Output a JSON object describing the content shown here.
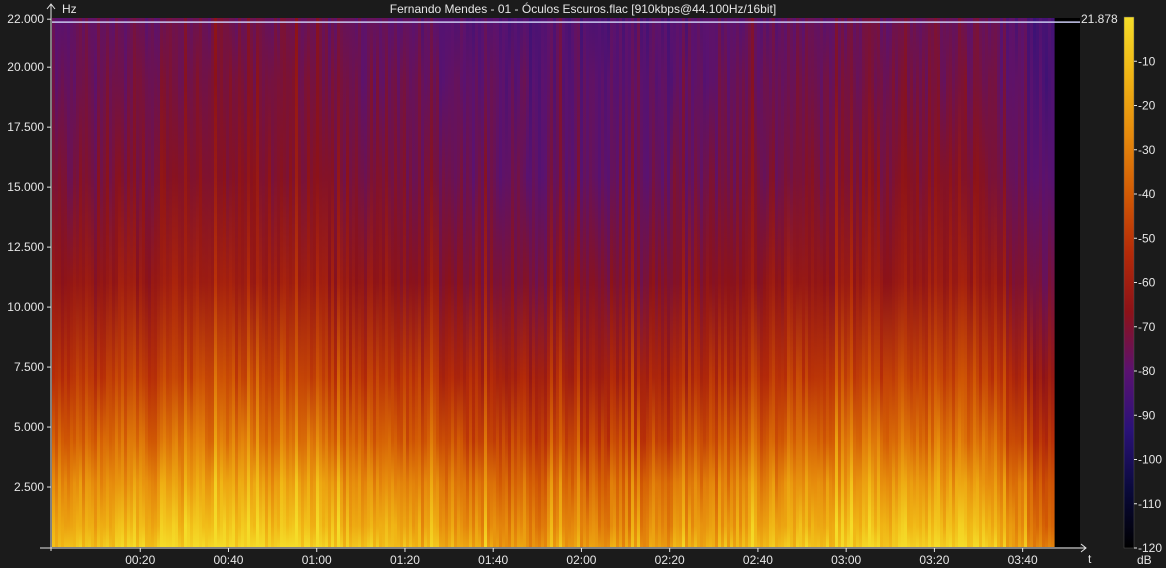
{
  "chart_data": {
    "type": "heatmap",
    "title": "Fernando Mendes - 01 - Óculos Escuros.flac [910kbps@44.100Hz/16bit]",
    "ylabel": "Hz",
    "xlabel": "t",
    "y_tick_labels": [
      "22.000",
      "20.000",
      "17.500",
      "15.000",
      "12.500",
      "10.000",
      "7.500",
      "5.000",
      "2.500"
    ],
    "y_tick_values": [
      22000,
      20000,
      17500,
      15000,
      12500,
      10000,
      7500,
      5000,
      2500
    ],
    "ylim": [
      0,
      22050
    ],
    "x_tick_labels": [
      "00:20",
      "00:40",
      "01:00",
      "01:20",
      "01:40",
      "02:00",
      "02:20",
      "02:40",
      "03:00",
      "03:20",
      "03:40"
    ],
    "x_tick_values": [
      20,
      40,
      60,
      80,
      100,
      120,
      140,
      160,
      180,
      200,
      220
    ],
    "xlim": [
      0,
      233
    ],
    "audio_end_seconds": 227,
    "cutoff_label": "21.878",
    "cutoff_hz": 21878,
    "colorbar": {
      "label": "dB",
      "tick_labels": [
        "-10",
        "-20",
        "-30",
        "-40",
        "-50",
        "-60",
        "-70",
        "-80",
        "-90",
        "-100",
        "-110",
        "-120"
      ],
      "tick_values": [
        -10,
        -20,
        -30,
        -40,
        -50,
        -60,
        -70,
        -80,
        -90,
        -100,
        -110,
        -120
      ],
      "range": [
        -120,
        0
      ],
      "colors": [
        "#000000",
        "#0a0a3c",
        "#2a1278",
        "#5a1270",
        "#8c1218",
        "#b42a08",
        "#d25a04",
        "#e68a0c",
        "#f0b414",
        "#f5dc28"
      ]
    }
  }
}
